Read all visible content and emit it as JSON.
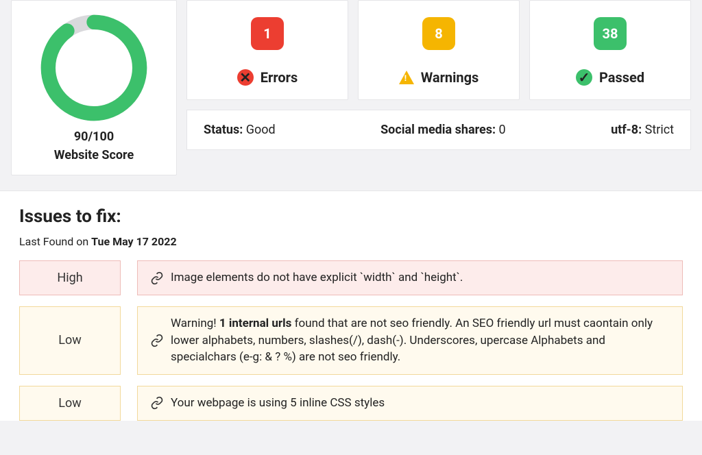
{
  "score": {
    "value": "90/100",
    "label": "Website Score",
    "percent": 90,
    "ring_fg": "#3cc06b",
    "ring_bg": "#d9d9dc"
  },
  "metrics": {
    "errors": {
      "count": "1",
      "label": "Errors",
      "badge_class": "red",
      "icon_class": "red"
    },
    "warnings": {
      "count": "8",
      "label": "Warnings",
      "badge_class": "yellow",
      "icon_class": "tri"
    },
    "passed": {
      "count": "38",
      "label": "Passed",
      "badge_class": "green",
      "icon_class": "green"
    }
  },
  "status_bar": {
    "status_label": "Status:",
    "status_value": " Good",
    "shares_label": "Social media shares:",
    "shares_value": " 0",
    "encoding_label": "utf-8:",
    "encoding_value": " Strict"
  },
  "issues": {
    "title": "Issues to fix:",
    "sub_prefix": "Last Found on ",
    "sub_date": "Tue May 17 2022",
    "items": [
      {
        "severity_label": "High",
        "severity_class": "sev-high",
        "desc_parts": [
          "Image elements do not have explicit `width` and `height`."
        ]
      },
      {
        "severity_label": "Low",
        "severity_class": "sev-low",
        "desc_parts": [
          "Warning! ",
          "1 internal urls",
          " found that are not seo friendly. An SEO friendly url must caontain only lower alphabets, numbers, slashes(/), dash(-). Underscores, upercase Alphabets and specialchars (e-g: & ? %) are not seo friendly."
        ]
      },
      {
        "severity_label": "Low",
        "severity_class": "sev-low",
        "desc_parts": [
          "Your webpage is using 5 inline CSS styles"
        ]
      }
    ]
  }
}
